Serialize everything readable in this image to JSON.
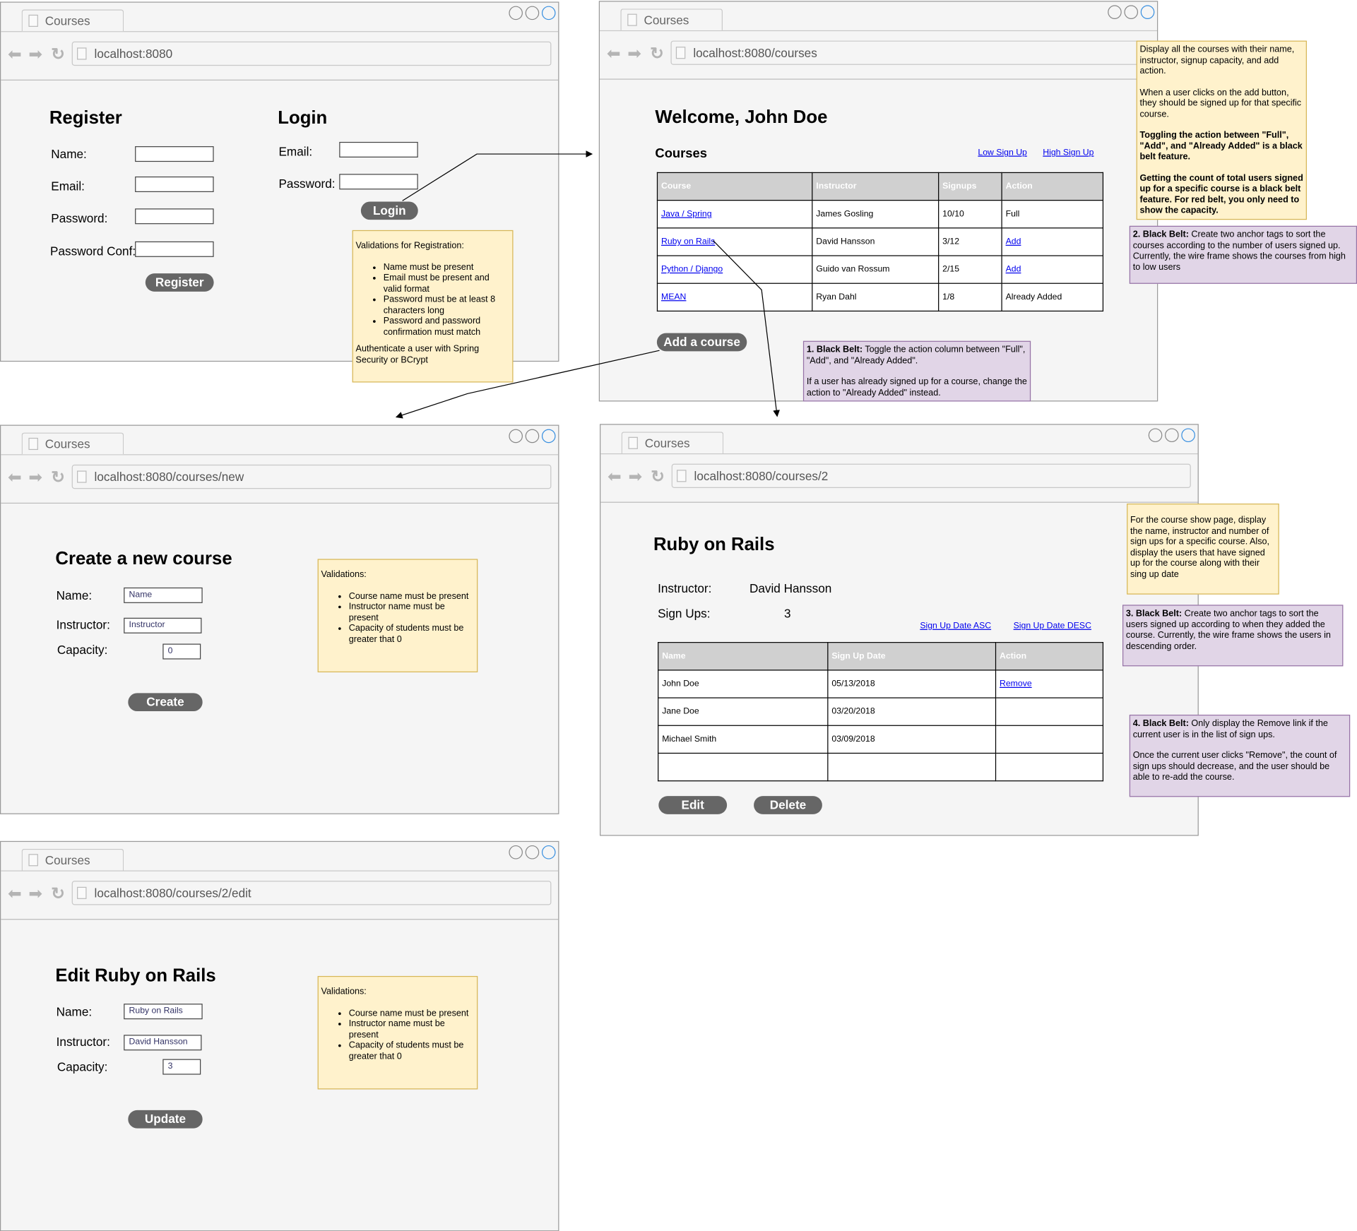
{
  "browser": {
    "tab_title": "Courses",
    "urls": {
      "login": "localhost:8080",
      "courses": "localhost:8080/courses",
      "new": "localhost:8080/courses/new",
      "show": "localhost:8080/courses/2",
      "edit": "localhost:8080/courses/2/edit"
    }
  },
  "login_page": {
    "register_title": "Register",
    "name_label": "Name:",
    "email_label": "Email:",
    "password_label": "Password:",
    "password_conf_label": "Password Conf:",
    "register_button": "Register",
    "login_title": "Login",
    "login_email_label": "Email:",
    "login_password_label": "Password:",
    "login_button": "Login",
    "note": {
      "title": "Validations for Registration:",
      "items": [
        "Name must be present",
        "Email must be present and valid format",
        "Password must be at least 8 characters long",
        "Password and password confirmation must match"
      ],
      "footer": "Authenticate a user with Spring Security or BCrypt"
    }
  },
  "courses_page": {
    "welcome": "Welcome, John Doe",
    "courses_title": "Courses",
    "low_sort": "Low Sign Up",
    "high_sort": "High Sign Up",
    "headers": [
      "Course",
      "Instructor",
      "Signups",
      "Action"
    ],
    "rows": [
      {
        "course": "Java / Spring",
        "instructor": "James Gosling",
        "signups": "10/10",
        "action": "Full",
        "action_link": false
      },
      {
        "course": "Ruby on Rails",
        "instructor": "David Hansson",
        "signups": "3/12",
        "action": "Add",
        "action_link": true
      },
      {
        "course": "Python / Django",
        "instructor": "Guido van Rossum",
        "signups": "2/15",
        "action": "Add",
        "action_link": true
      },
      {
        "course": "MEAN",
        "instructor": "Ryan Dahl",
        "signups": "1/8",
        "action": "Already Added",
        "action_link": false
      }
    ],
    "add_course_button": "Add a course",
    "note_main": {
      "p1": "Display all the courses with their name, instructor, signup capacity, and add action.",
      "p2": "When a user clicks on the add button, they should be signed up for that specific course.",
      "p3": "Toggling the action between \"Full\", \"Add\", and \"Already Added\" is a black belt feature.",
      "p4": "Getting the count of total users signed up for a specific course is a black belt feature. For red belt, you only need to show the capacity."
    },
    "note_bb1": {
      "bold": "1. Black Belt:",
      "text": " Toggle the action column between \"Full\", \"Add\", and \"Already Added\".",
      "p2": "If a user has already signed up for a course, change the action to \"Already Added\" instead."
    },
    "note_bb2": {
      "bold": "2. Black Belt:",
      "text": " Create two anchor tags to sort the courses according to the number of users signed up. Currently, the wire frame shows the courses from high to low users"
    }
  },
  "new_page": {
    "title": "Create a new course",
    "name_label": "Name:",
    "name_placeholder": "Name",
    "instructor_label": "Instructor:",
    "instructor_placeholder": "Instructor",
    "capacity_label": "Capacity:",
    "capacity_value": "0",
    "create_button": "Create"
  },
  "validations_note": {
    "title": "Validations:",
    "items": [
      "Course name must be present",
      "Instructor name must be present",
      "Capacity of students must be greater that 0"
    ]
  },
  "show_page": {
    "title": "Ruby on Rails",
    "instructor_label": "Instructor:",
    "instructor_value": "David Hansson",
    "signups_label": "Sign Ups:",
    "signups_value": "3",
    "asc_sort": "Sign Up Date ASC",
    "desc_sort": "Sign Up Date DESC",
    "headers": [
      "Name",
      "Sign Up Date",
      "Action"
    ],
    "rows": [
      {
        "name": "John Doe",
        "date": "05/13/2018",
        "action": "Remove"
      },
      {
        "name": "Jane Doe",
        "date": "03/20/2018",
        "action": ""
      },
      {
        "name": "Michael Smith",
        "date": "03/09/2018",
        "action": ""
      },
      {
        "name": "",
        "date": "",
        "action": ""
      }
    ],
    "edit_button": "Edit",
    "delete_button": "Delete",
    "note_main": "For the course show page, display the name, instructor and number of sign ups for a specific course. Also, display the users that have signed up for the course along with their sing up date",
    "note_bb3": {
      "bold": "3. Black Belt:",
      "text": " Create two anchor tags to sort the users signed up according to when they added the course. Currently, the wire frame shows the users in descending order."
    },
    "note_bb4": {
      "bold": "4. Black Belt:",
      "text": " Only display the Remove link if the current user is in the list of sign ups.",
      "p2": "Once the current user clicks \"Remove\", the count of sign ups should decrease, and the user should be able to re-add the course."
    }
  },
  "edit_page": {
    "title": "Edit Ruby on Rails",
    "name_label": "Name:",
    "name_value": "Ruby on Rails",
    "instructor_label": "Instructor:",
    "instructor_value": "David Hansson",
    "capacity_label": "Capacity:",
    "capacity_value": "3",
    "update_button": "Update"
  }
}
